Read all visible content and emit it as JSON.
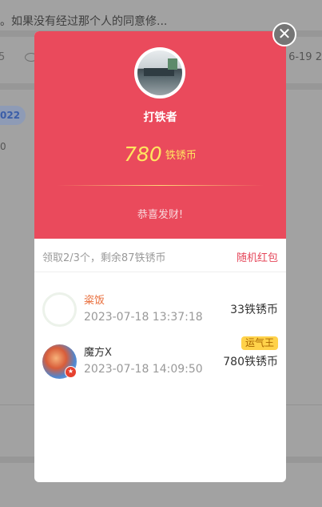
{
  "background": {
    "top_text": "。如果没有经过那个人的同意修...",
    "row_left": "5",
    "row_right": "6-19 2",
    "tag": "022",
    "small_char": "0"
  },
  "modal": {
    "sender_name": "打铁者",
    "amount": "780",
    "amount_unit": "铁锈币",
    "greeting": "恭喜发财!",
    "summary": "领取2/3个，剩余87铁锈币",
    "packet_type": "随机红包",
    "close_icon": "close-icon",
    "receivers": [
      {
        "name": "粢饭",
        "name_color": "#e96f3d",
        "time": "2023-07-18 13:37:18",
        "amount": "33铁锈币",
        "badge": ""
      },
      {
        "name": "魔方X",
        "name_color": "#333333",
        "time": "2023-07-18 14:09:50",
        "amount": "780铁锈币",
        "badge": "运气王"
      }
    ]
  },
  "colors": {
    "accent_red": "#ea4a5c",
    "amount_yellow": "#ffe560",
    "packet_type_red": "#e5475a",
    "luck_badge_bg": "#ffd24a"
  }
}
